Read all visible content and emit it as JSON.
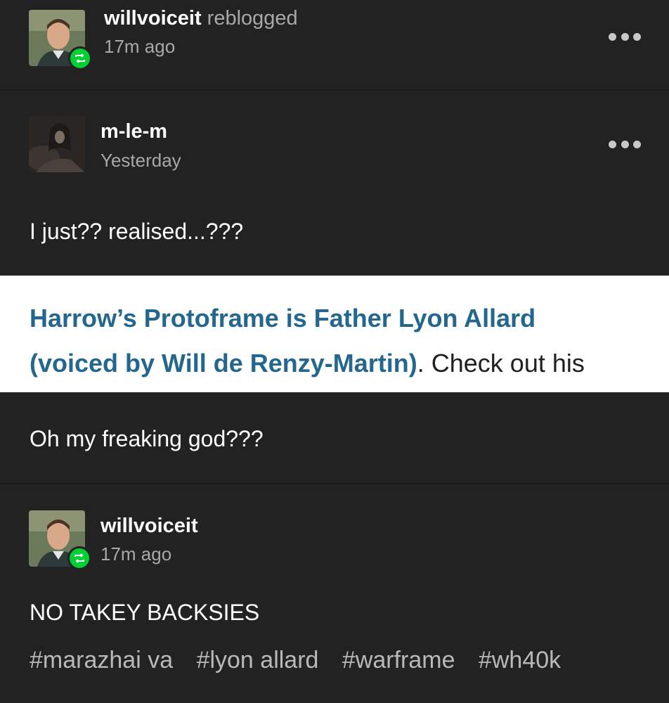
{
  "reblog_header": {
    "username": "willvoiceit",
    "action": "reblogged",
    "time": "17m ago"
  },
  "original_post": {
    "username": "m-le-m",
    "time": "Yesterday",
    "text1": "I just?? realised...???",
    "quote": {
      "line1": "Harrow’s Protoframe is Father Lyon Allard",
      "line2_link": "(voiced by Will de Renzy-Martin)",
      "line2_plain": ". Check out his"
    },
    "text2": "Oh my freaking god???"
  },
  "reblog_comment": {
    "username": "willvoiceit",
    "time": "17m ago",
    "text": "NO TAKEY BACKSIES"
  },
  "tags": [
    "#marazhai va",
    "#lyon allard",
    "#warframe",
    "#wh40k"
  ],
  "colors": {
    "background": "#222222",
    "reblog_badge": "#00cf35",
    "quote_link": "#23678e",
    "muted_text": "#a8a8a8"
  }
}
